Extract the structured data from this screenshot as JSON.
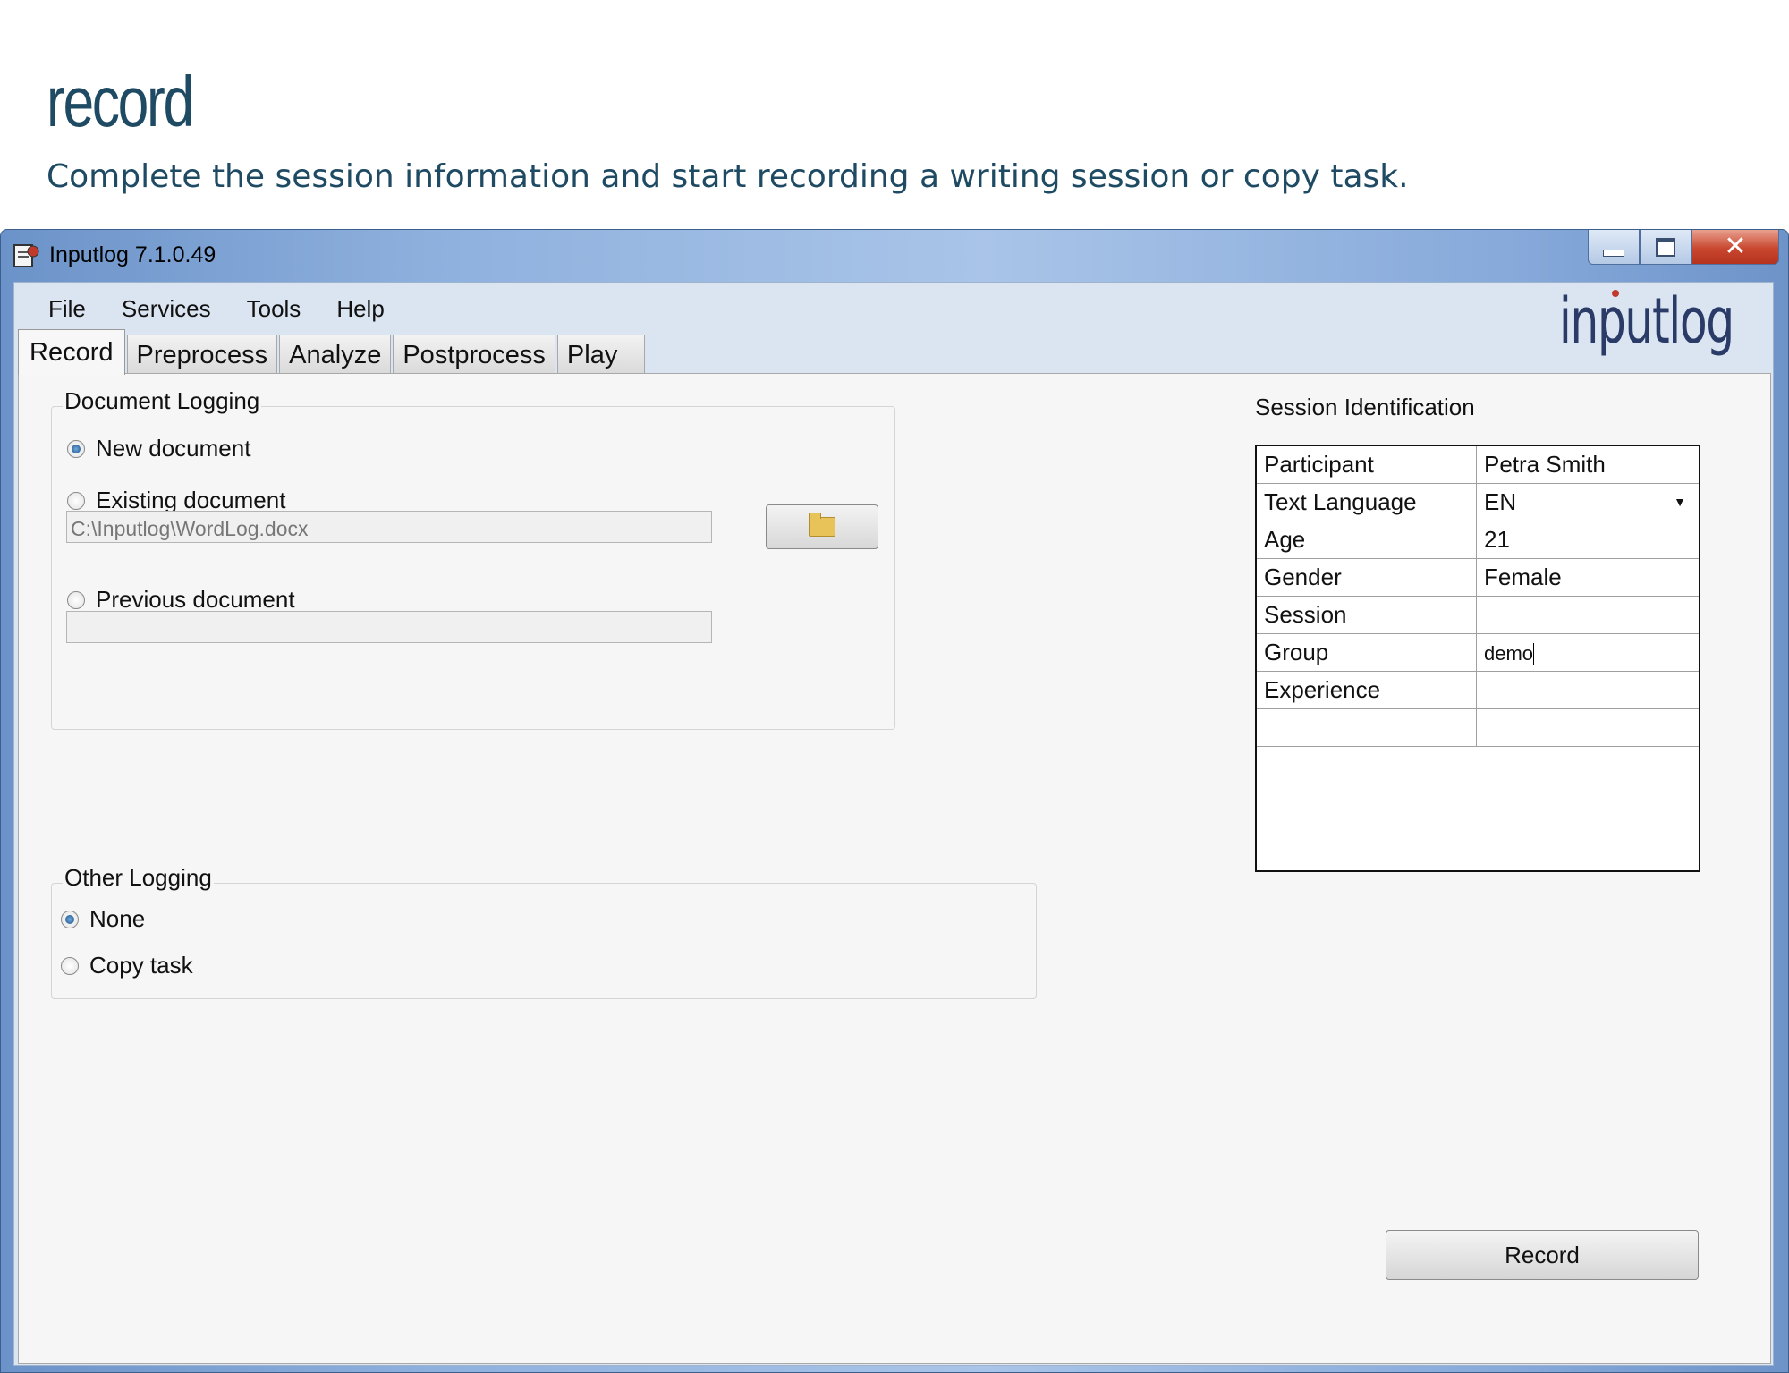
{
  "page": {
    "title": "record",
    "subtitle": "Complete the session information and start recording a writing session or copy task."
  },
  "window": {
    "title": "Inputlog 7.1.0.49",
    "logo": "inputlog"
  },
  "menu": [
    "File",
    "Services",
    "Tools",
    "Help"
  ],
  "tabs": [
    "Record",
    "Preprocess",
    "Analyze",
    "Postprocess",
    "Play"
  ],
  "document_logging": {
    "label": "Document Logging",
    "options": [
      "New document",
      "Existing document",
      "Previous document"
    ],
    "selected": "New document",
    "existing_path": "C:\\Inputlog\\WordLog.docx",
    "previous_path": ""
  },
  "other_logging": {
    "label": "Other Logging",
    "options": [
      "None",
      "Copy task"
    ],
    "selected": "None"
  },
  "session": {
    "label": "Session Identification",
    "rows": [
      {
        "key": "Participant",
        "value": "Petra Smith"
      },
      {
        "key": "Text Language",
        "value": "EN"
      },
      {
        "key": "Age",
        "value": "21"
      },
      {
        "key": "Gender",
        "value": "Female"
      },
      {
        "key": "Session",
        "value": ""
      },
      {
        "key": "Group",
        "value": "demo"
      },
      {
        "key": "Experience",
        "value": ""
      },
      {
        "key": "",
        "value": ""
      }
    ]
  },
  "record_button": "Record",
  "colors": {
    "heading": "#1e4a63",
    "titlebar": "#86a9da",
    "close": "#c9472f"
  }
}
